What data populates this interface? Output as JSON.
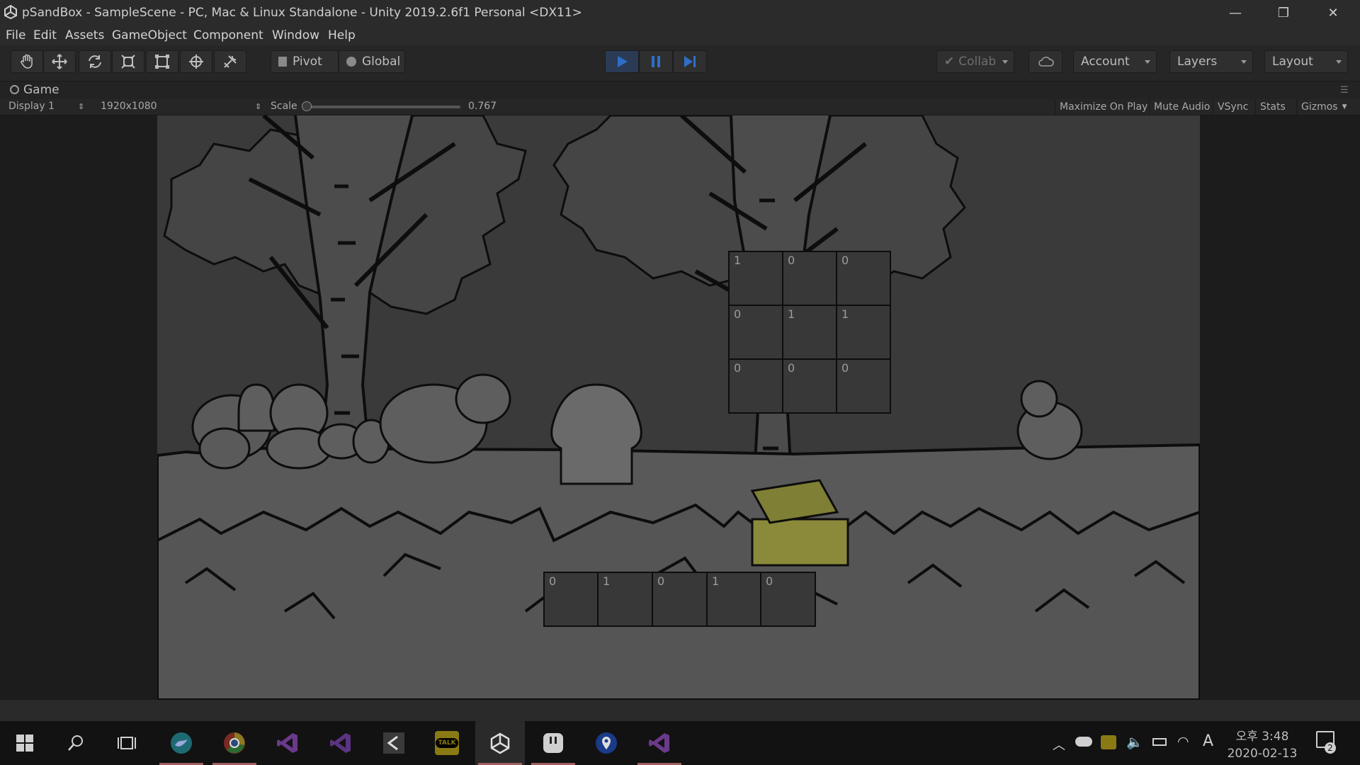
{
  "window": {
    "title": "pSandBox - SampleScene - PC, Mac & Linux Standalone - Unity 2019.2.6f1 Personal <DX11>",
    "controls": {
      "minimize": "—",
      "restore": "❐",
      "close": "✕"
    }
  },
  "menu": {
    "items": [
      "File",
      "Edit",
      "Assets",
      "GameObject",
      "Component",
      "Window",
      "Help"
    ]
  },
  "toolbar": {
    "tools": [
      "hand-tool",
      "move-tool",
      "rotate-tool",
      "scale-tool",
      "rect-tool",
      "transform-tool",
      "custom-tool"
    ],
    "pivot_label": "Pivot",
    "global_label": "Global",
    "collab_label": "Collab",
    "account_label": "Account",
    "layers_label": "Layers",
    "layout_label": "Layout"
  },
  "game_view": {
    "tab_label": "Game",
    "display": "Display 1",
    "resolution": "1920x1080",
    "scale_label": "Scale",
    "scale_value": "0.767",
    "scale_fraction": 0.0,
    "buttons": [
      "Maximize On Play",
      "Mute Audio",
      "VSync",
      "Stats",
      "Gizmos"
    ]
  },
  "scene": {
    "grid_top": [
      [
        "1",
        "0",
        "0"
      ],
      [
        "0",
        "1",
        "1"
      ],
      [
        "0",
        "0",
        "0"
      ]
    ],
    "grid_bottom": [
      "0",
      "1",
      "0",
      "1",
      "0"
    ],
    "colors": {
      "chest": "#8a8a3a",
      "background": "#3a3a3a"
    }
  },
  "taskbar": {
    "icons": [
      "windows-start-icon",
      "search-icon",
      "task-view-icon",
      "twitter-app-icon",
      "chrome-icon",
      "visual-studio-icon",
      "visual-studio-icon-2",
      "unity-hub-icon",
      "kakaotalk-icon",
      "unity-icon",
      "app-icon",
      "maps-icon",
      "visual-studio-icon-3"
    ],
    "kakaotalk_label": "TALK",
    "clock_time": "오후 3:48",
    "clock_date": "2020-02-13",
    "ime_label": "A",
    "notification_count": "2"
  }
}
